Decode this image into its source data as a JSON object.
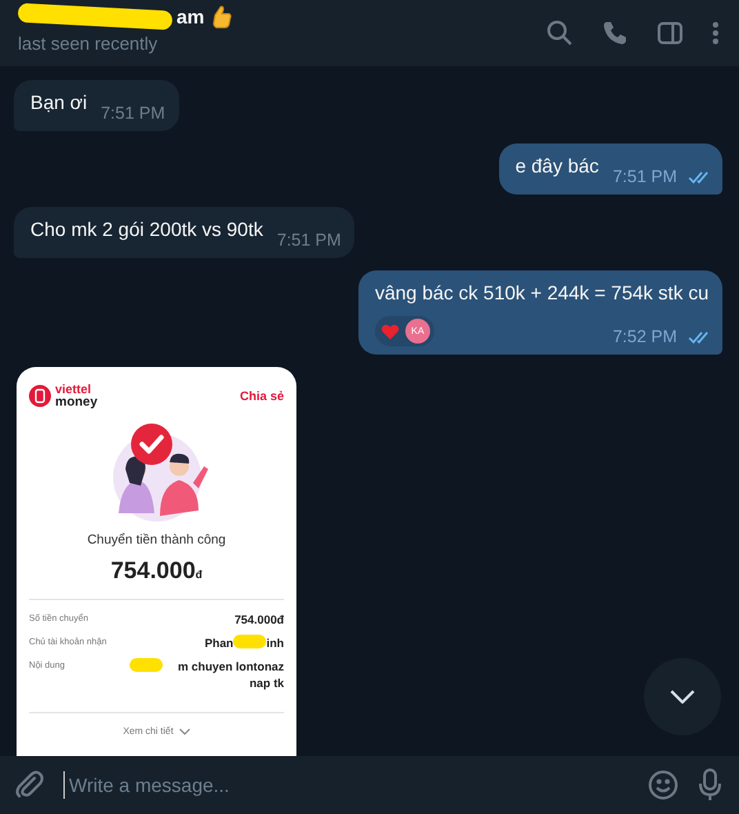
{
  "header": {
    "title": [
      {
        "kind": "redaction"
      },
      {
        "kind": "text",
        "text": "am"
      }
    ],
    "status": "last seen recently"
  },
  "messages": [
    {
      "kind": "text",
      "outgoing": false,
      "text": "Bạn ơi",
      "time": "7:51 PM"
    },
    {
      "kind": "text",
      "outgoing": true,
      "text": "e đây bác",
      "time": "7:51 PM",
      "read": true
    },
    {
      "kind": "text",
      "outgoing": false,
      "text": "Cho mk 2 gói 200tk vs 90tk",
      "time": "7:51 PM"
    },
    {
      "kind": "text",
      "outgoing": true,
      "text": "vâng bác ck 510k + 244k = 754k stk cu",
      "time": "7:52 PM",
      "read": true,
      "reactions": [
        {
          "avatar": "KA"
        }
      ]
    },
    {
      "kind": "image",
      "outgoing": false,
      "receipt": {
        "brand_top": "viettel",
        "brand_bottom": "money",
        "share": "Chia sẻ",
        "status": "Chuyển tiền thành công",
        "amount": "754.000",
        "currency": "đ",
        "rows": [
          {
            "label": "Số tiền chuyển",
            "value": [
              {
                "kind": "text",
                "text": "754.000đ"
              }
            ]
          },
          {
            "label": "Chủ tài khoản nhận",
            "value": [
              {
                "kind": "text",
                "text": "Phan"
              },
              {
                "kind": "redaction"
              },
              {
                "kind": "text",
                "text": "inh"
              }
            ]
          },
          {
            "label": "Nội dung",
            "value": [
              {
                "kind": "redaction"
              },
              {
                "kind": "text",
                "text": "m chuyen lontonaz nap tk"
              }
            ]
          }
        ],
        "details": "Xem chi tiết"
      }
    }
  ],
  "composer": {
    "placeholder": "Write a message..."
  }
}
